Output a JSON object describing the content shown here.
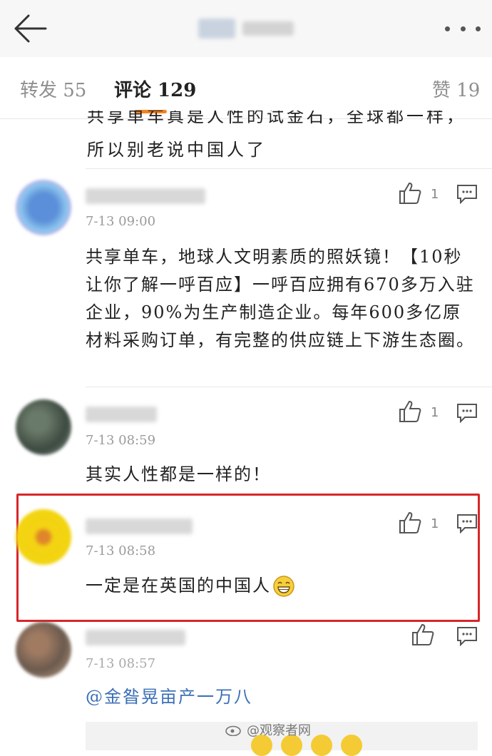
{
  "header": {
    "back_icon": "arrow-left-icon",
    "more_icon": "more-dots-icon"
  },
  "tabs": {
    "repost": "转发 55",
    "comments": "评论 129",
    "likes": "赞 19"
  },
  "cut_comment": {
    "partial_line": "共享单车真是人性的试金石，全球都一样，",
    "last_line": "所以别老说中国人了"
  },
  "comments": [
    {
      "time": "7-13 09:00",
      "likes": "1",
      "body": "共享单车，地球人文明素质的照妖镜！【10秒让你了解一呼百应】一呼百应拥有670多万入驻企业，90%为生产制造企业。每年600多亿原材料采购订单，有完整的供应链上下游生态圈。"
    },
    {
      "time": "7-13 08:59",
      "likes": "1",
      "body": "其实人性都是一样的！"
    },
    {
      "time": "7-13 08:58",
      "likes": "1",
      "body": "一定是在英国的中国人"
    },
    {
      "time": "7-13 08:57",
      "likes": "",
      "body": "@金昝晃亩产一万八"
    }
  ],
  "watermark": "@观察者网",
  "colors": {
    "accent": "#f5821f",
    "highlight_border": "#d8262a"
  }
}
